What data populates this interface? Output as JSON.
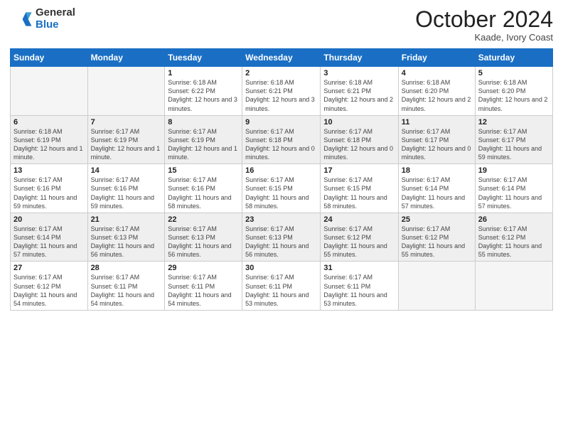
{
  "header": {
    "logo_general": "General",
    "logo_blue": "Blue",
    "month": "October 2024",
    "location": "Kaade, Ivory Coast"
  },
  "days_of_week": [
    "Sunday",
    "Monday",
    "Tuesday",
    "Wednesday",
    "Thursday",
    "Friday",
    "Saturday"
  ],
  "weeks": [
    [
      {
        "day": "",
        "info": ""
      },
      {
        "day": "",
        "info": ""
      },
      {
        "day": "1",
        "info": "Sunrise: 6:18 AM\nSunset: 6:22 PM\nDaylight: 12 hours and 3 minutes."
      },
      {
        "day": "2",
        "info": "Sunrise: 6:18 AM\nSunset: 6:21 PM\nDaylight: 12 hours and 3 minutes."
      },
      {
        "day": "3",
        "info": "Sunrise: 6:18 AM\nSunset: 6:21 PM\nDaylight: 12 hours and 2 minutes."
      },
      {
        "day": "4",
        "info": "Sunrise: 6:18 AM\nSunset: 6:20 PM\nDaylight: 12 hours and 2 minutes."
      },
      {
        "day": "5",
        "info": "Sunrise: 6:18 AM\nSunset: 6:20 PM\nDaylight: 12 hours and 2 minutes."
      }
    ],
    [
      {
        "day": "6",
        "info": "Sunrise: 6:18 AM\nSunset: 6:19 PM\nDaylight: 12 hours and 1 minute."
      },
      {
        "day": "7",
        "info": "Sunrise: 6:17 AM\nSunset: 6:19 PM\nDaylight: 12 hours and 1 minute."
      },
      {
        "day": "8",
        "info": "Sunrise: 6:17 AM\nSunset: 6:19 PM\nDaylight: 12 hours and 1 minute."
      },
      {
        "day": "9",
        "info": "Sunrise: 6:17 AM\nSunset: 6:18 PM\nDaylight: 12 hours and 0 minutes."
      },
      {
        "day": "10",
        "info": "Sunrise: 6:17 AM\nSunset: 6:18 PM\nDaylight: 12 hours and 0 minutes."
      },
      {
        "day": "11",
        "info": "Sunrise: 6:17 AM\nSunset: 6:17 PM\nDaylight: 12 hours and 0 minutes."
      },
      {
        "day": "12",
        "info": "Sunrise: 6:17 AM\nSunset: 6:17 PM\nDaylight: 11 hours and 59 minutes."
      }
    ],
    [
      {
        "day": "13",
        "info": "Sunrise: 6:17 AM\nSunset: 6:16 PM\nDaylight: 11 hours and 59 minutes."
      },
      {
        "day": "14",
        "info": "Sunrise: 6:17 AM\nSunset: 6:16 PM\nDaylight: 11 hours and 59 minutes."
      },
      {
        "day": "15",
        "info": "Sunrise: 6:17 AM\nSunset: 6:16 PM\nDaylight: 11 hours and 58 minutes."
      },
      {
        "day": "16",
        "info": "Sunrise: 6:17 AM\nSunset: 6:15 PM\nDaylight: 11 hours and 58 minutes."
      },
      {
        "day": "17",
        "info": "Sunrise: 6:17 AM\nSunset: 6:15 PM\nDaylight: 11 hours and 58 minutes."
      },
      {
        "day": "18",
        "info": "Sunrise: 6:17 AM\nSunset: 6:14 PM\nDaylight: 11 hours and 57 minutes."
      },
      {
        "day": "19",
        "info": "Sunrise: 6:17 AM\nSunset: 6:14 PM\nDaylight: 11 hours and 57 minutes."
      }
    ],
    [
      {
        "day": "20",
        "info": "Sunrise: 6:17 AM\nSunset: 6:14 PM\nDaylight: 11 hours and 57 minutes."
      },
      {
        "day": "21",
        "info": "Sunrise: 6:17 AM\nSunset: 6:13 PM\nDaylight: 11 hours and 56 minutes."
      },
      {
        "day": "22",
        "info": "Sunrise: 6:17 AM\nSunset: 6:13 PM\nDaylight: 11 hours and 56 minutes."
      },
      {
        "day": "23",
        "info": "Sunrise: 6:17 AM\nSunset: 6:13 PM\nDaylight: 11 hours and 56 minutes."
      },
      {
        "day": "24",
        "info": "Sunrise: 6:17 AM\nSunset: 6:12 PM\nDaylight: 11 hours and 55 minutes."
      },
      {
        "day": "25",
        "info": "Sunrise: 6:17 AM\nSunset: 6:12 PM\nDaylight: 11 hours and 55 minutes."
      },
      {
        "day": "26",
        "info": "Sunrise: 6:17 AM\nSunset: 6:12 PM\nDaylight: 11 hours and 55 minutes."
      }
    ],
    [
      {
        "day": "27",
        "info": "Sunrise: 6:17 AM\nSunset: 6:12 PM\nDaylight: 11 hours and 54 minutes."
      },
      {
        "day": "28",
        "info": "Sunrise: 6:17 AM\nSunset: 6:11 PM\nDaylight: 11 hours and 54 minutes."
      },
      {
        "day": "29",
        "info": "Sunrise: 6:17 AM\nSunset: 6:11 PM\nDaylight: 11 hours and 54 minutes."
      },
      {
        "day": "30",
        "info": "Sunrise: 6:17 AM\nSunset: 6:11 PM\nDaylight: 11 hours and 53 minutes."
      },
      {
        "day": "31",
        "info": "Sunrise: 6:17 AM\nSunset: 6:11 PM\nDaylight: 11 hours and 53 minutes."
      },
      {
        "day": "",
        "info": ""
      },
      {
        "day": "",
        "info": ""
      }
    ]
  ]
}
